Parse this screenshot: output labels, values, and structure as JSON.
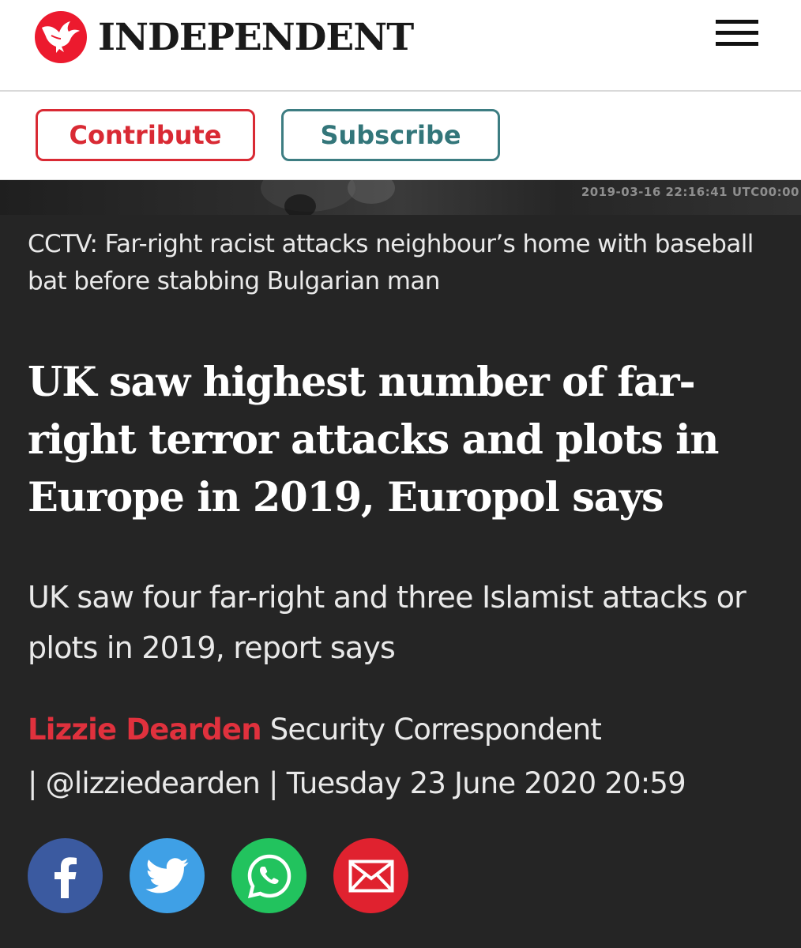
{
  "header": {
    "logo_text": "INDEPENDENT",
    "menu_icon": "hamburger-menu-icon",
    "brand_color": "#ec1a2e"
  },
  "actions": {
    "contribute_label": "Contribute",
    "subscribe_label": "Subscribe",
    "contribute_color": "#d92a34",
    "subscribe_color": "#33767a"
  },
  "video": {
    "timestamp": "2019-03-16 22:16:41 UTC00:00",
    "caption": "CCTV: Far-right racist attacks neighbour’s home with baseball bat before stabbing Bulgarian man"
  },
  "article": {
    "headline": "UK saw highest number of far-right terror attacks and plots in Europe in 2019, Europol says",
    "standfirst": "UK saw four far-right and three Islamist attacks or plots in 2019, report says",
    "byline": {
      "author": "Lizzie Dearden",
      "role": "Security Correspondent",
      "handle": "@lizziedearden",
      "date": "Tuesday 23 June 2020 20:59",
      "separator": "|"
    }
  },
  "share": {
    "icons": [
      "facebook-icon",
      "twitter-icon",
      "whatsapp-icon",
      "email-icon"
    ],
    "colors": {
      "facebook": "#3b5aa0",
      "twitter": "#3fa0e6",
      "whatsapp": "#22c35e",
      "email": "#e0222f"
    }
  }
}
